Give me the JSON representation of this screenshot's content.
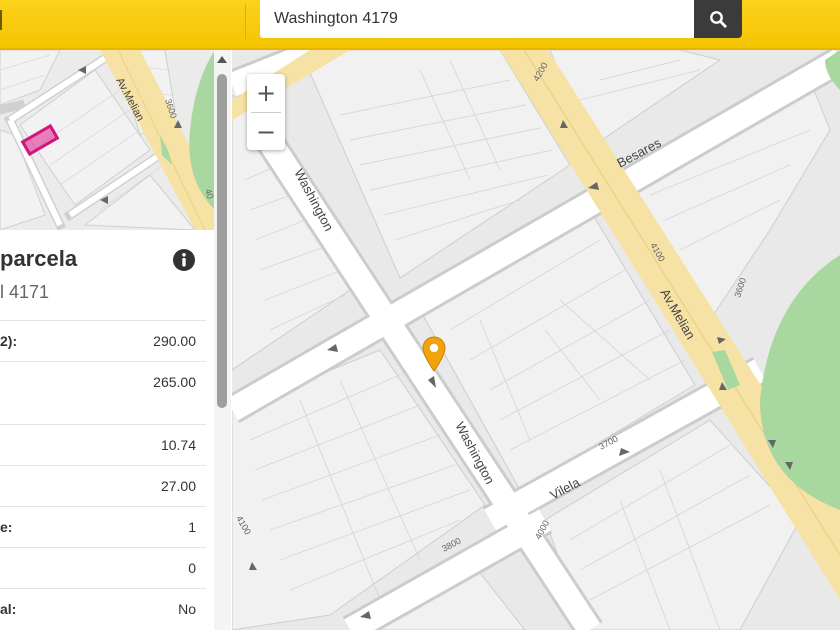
{
  "search": {
    "value": "Washington 4179",
    "button_icon": "search-icon"
  },
  "panel": {
    "title": "parcela",
    "subtitle": "l 4171",
    "info_icon": "info-icon",
    "rows": [
      {
        "label": "2):",
        "value": "290.00"
      },
      {
        "label": "",
        "value": "265.00"
      },
      {
        "label": "",
        "value": "10.74"
      },
      {
        "label": "",
        "value": "27.00"
      },
      {
        "label": "e:",
        "value": "1"
      },
      {
        "label": "",
        "value": "0"
      },
      {
        "label": "al:",
        "value": "No"
      }
    ]
  },
  "map": {
    "labels": {
      "washington_top": "Washington",
      "washington_mid": "Washington",
      "melian_main": "Av.Melian",
      "melian_mini": "Av.Melian",
      "besares": "Besares",
      "vilela": "Vilela",
      "n4200": "4200",
      "n4100a": "4100",
      "n3600a": "3600",
      "n3700": "3700",
      "n4000": "4000",
      "n3800": "3800",
      "n4100b": "4100",
      "n3600mini": "3600",
      "n40mini": "40"
    },
    "zoom_in": "+",
    "zoom_out": "−",
    "colors": {
      "road": "#ffffff",
      "avenue": "#f6e2a4",
      "block": "#ececec",
      "park": "#a8d8a0",
      "marker": "#f0a30a",
      "highlight": "#e0208c"
    }
  }
}
